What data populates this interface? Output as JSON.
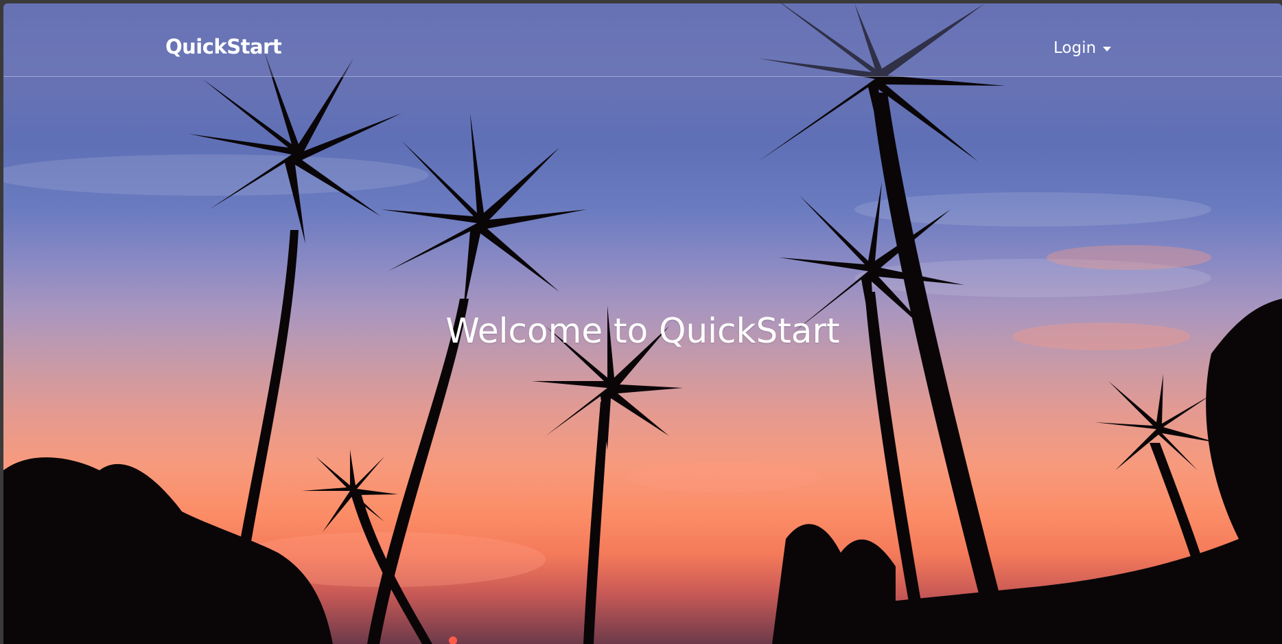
{
  "navbar": {
    "brand": "QuickStart",
    "login_label": "Login",
    "login_icon": "caret-down-icon"
  },
  "hero": {
    "headline": "Welcome to QuickStart",
    "background": "sunset-palm-trees-image"
  },
  "colors": {
    "navbar_overlay": "#7882be",
    "text": "#ffffff",
    "sky_top": "#5d6ab0",
    "sky_bottom": "#f47a5a"
  }
}
